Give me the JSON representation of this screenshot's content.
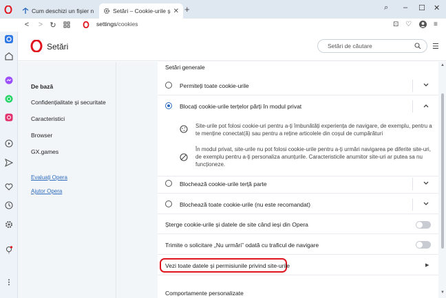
{
  "tabs": [
    {
      "title": "Cum deschizi un fișier nec",
      "active": false
    },
    {
      "title": "Setări – Cookie-urile și alte",
      "active": true
    }
  ],
  "address": {
    "host": "settings",
    "path": "/cookies"
  },
  "header": {
    "title": "Setări",
    "search_placeholder": "Setări de căutare"
  },
  "nav": {
    "items": [
      {
        "label": "De bază",
        "selected": true
      },
      {
        "label": "Confidențialitate și securitate",
        "selected": false
      },
      {
        "label": "Caracteristici",
        "selected": false
      },
      {
        "label": "Browser",
        "selected": false
      },
      {
        "label": "GX.games",
        "selected": false
      }
    ],
    "links": [
      "Evaluați Opera",
      "Ajutor Opera"
    ]
  },
  "content": {
    "general_title": "Setări generale",
    "options": [
      {
        "label": "Permiteți toate cookie-urile",
        "checked": false,
        "expanded": false
      },
      {
        "label": "Blocați cookie-urile terțelor părți în modul privat",
        "checked": true,
        "expanded": true
      },
      {
        "label": "Blochează cookie-urile terță parte",
        "checked": false,
        "expanded": false
      },
      {
        "label": "Blochează toate cookie-urile (nu este recomandat)",
        "checked": false,
        "expanded": false
      }
    ],
    "expanded_desc": [
      "Site-urile pot folosi cookie-uri pentru a-ți îmbunătăți experiența de navigare, de exemplu, pentru a te menține conectat(ă) sau pentru a reține articolele din coșul de cumpărături",
      "În modul privat, site-urile nu pot folosi cookie-urile pentru a-ți urmări navigarea pe diferite site-uri, de exemplu pentru a-ți personaliza anunțurile. Caracteristicile anumitor site-uri ar putea sa nu funcționeze."
    ],
    "toggles": [
      {
        "label": "Șterge cookie-urile și datele de site când ieși din Opera",
        "on": false
      },
      {
        "label": "Trimite o solicitare „Nu urmări” odată cu traficul de navigare",
        "on": false
      }
    ],
    "site_data_link": "Vezi toate datele și permisiunile privind site-urile",
    "custom_title": "Comportamente personalizate"
  },
  "colors": {
    "accent": "#2c6bbd",
    "opera_red": "#e0141e",
    "highlight": "#e0141e"
  }
}
